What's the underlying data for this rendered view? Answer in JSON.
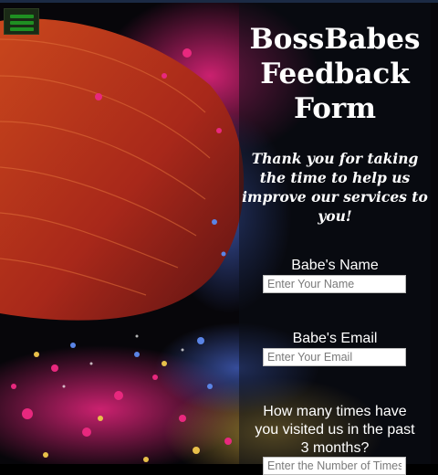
{
  "header": {
    "menu_icon": "hamburger-menu-icon",
    "menu_color": "#1f8f22"
  },
  "form": {
    "title": "BossBabes Feedback Form",
    "subtitle": "Thank you for taking the time to help us improve our services to you!",
    "fields": [
      {
        "label": "Babe's Name",
        "placeholder": "Enter Your Name"
      },
      {
        "label": "Babe's Email",
        "placeholder": "Enter Your Email"
      },
      {
        "label": "How many times have you visited us in the past 3 months?",
        "placeholder": "Enter the Number of Times"
      }
    ]
  }
}
